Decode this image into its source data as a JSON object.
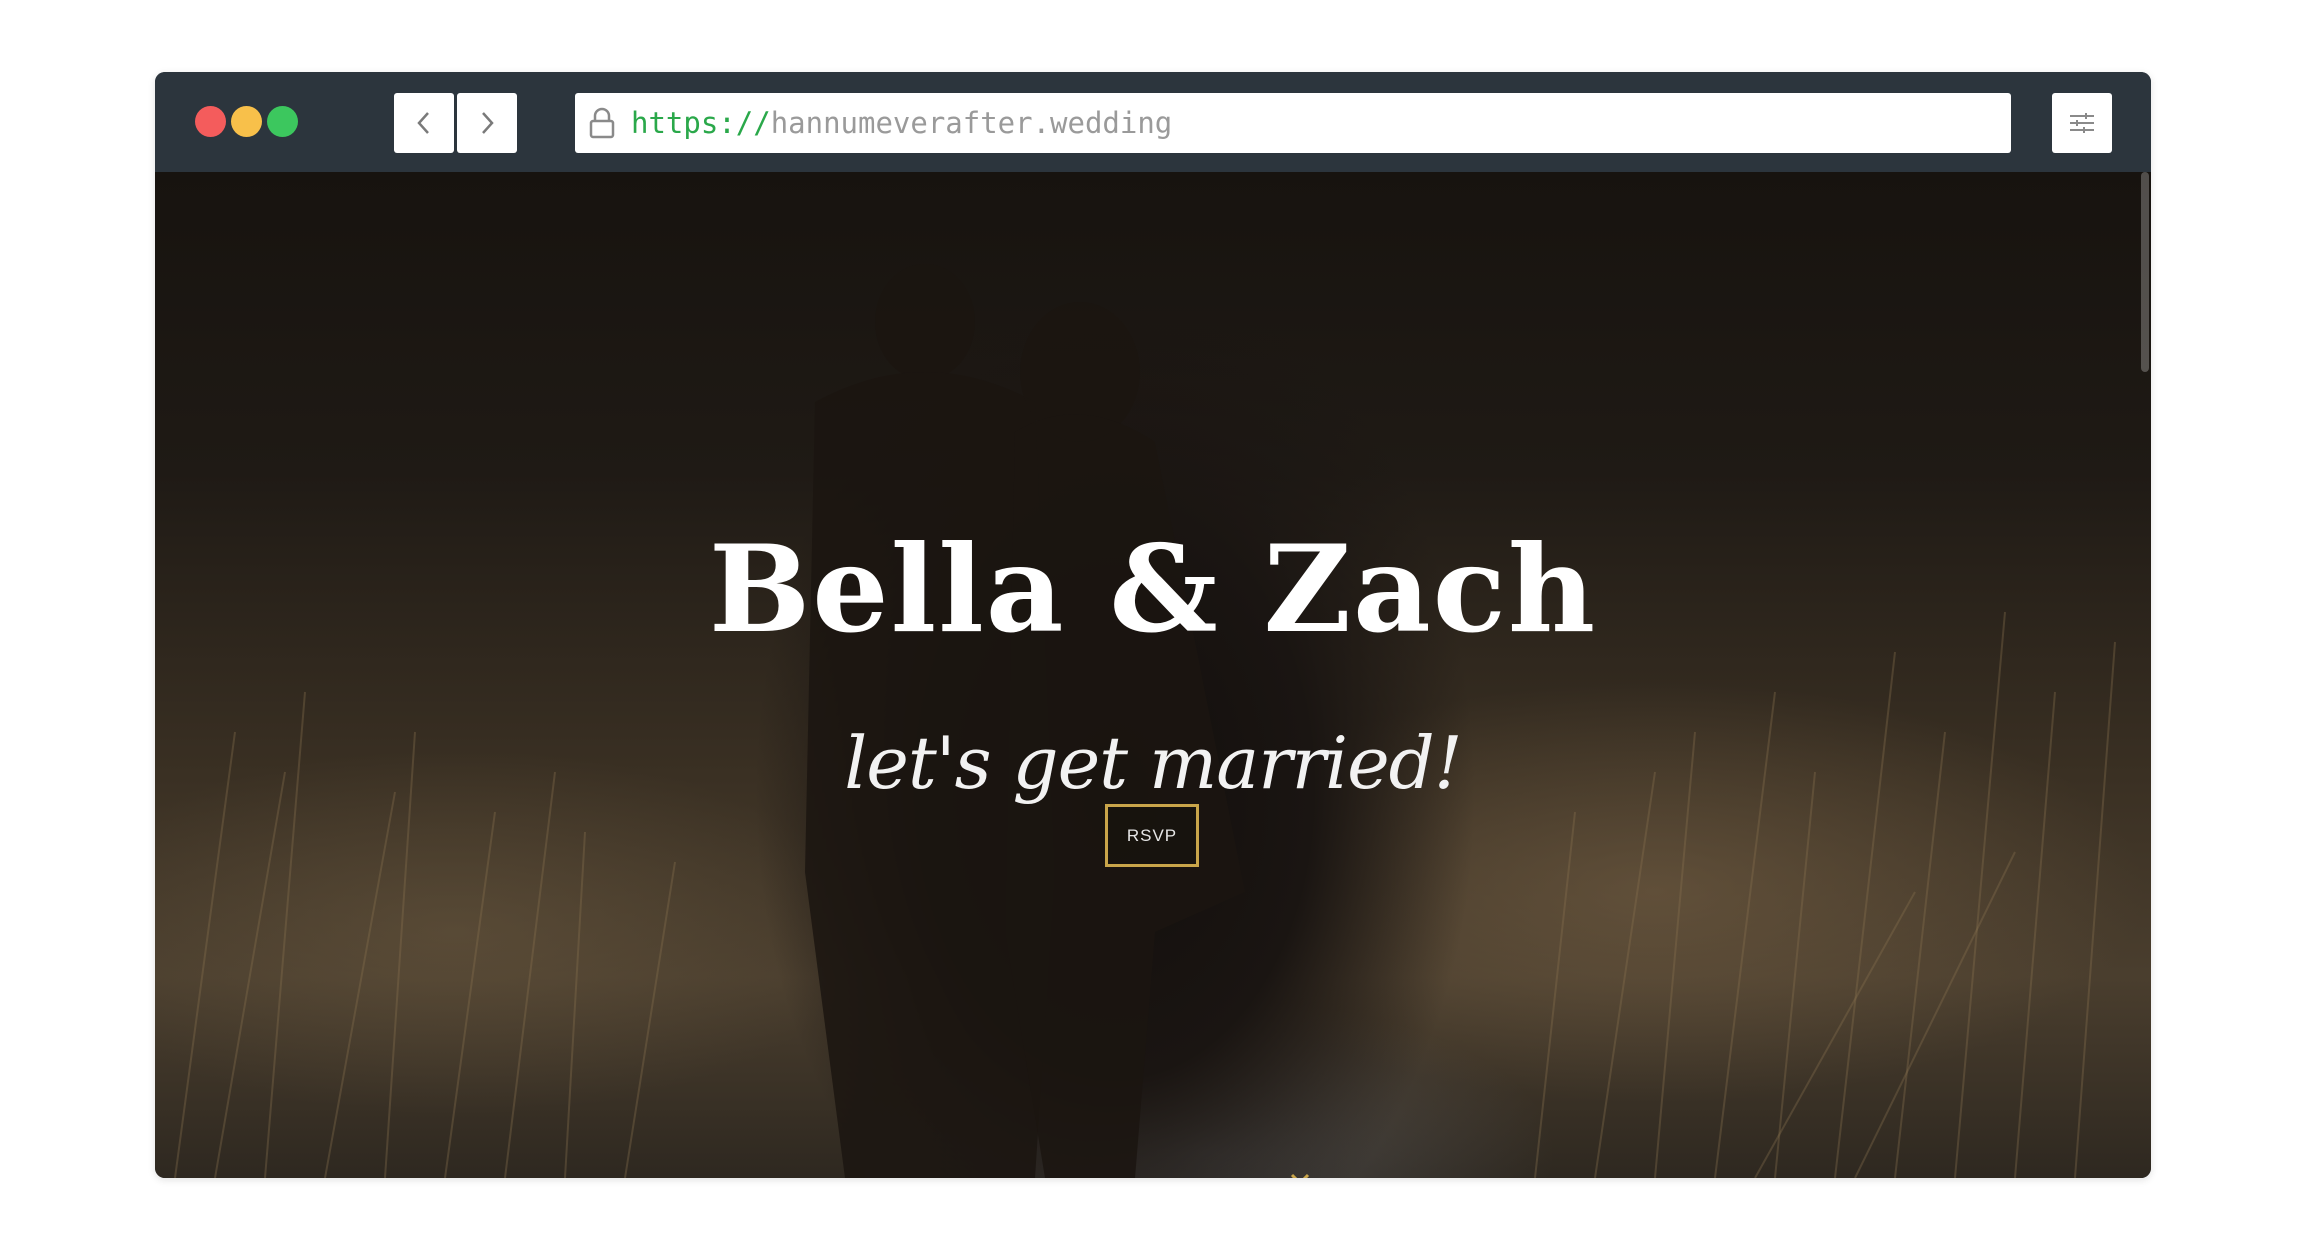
{
  "browser": {
    "url_scheme": "https://",
    "url_host": "hannumeverafter.wedding",
    "icons": {
      "back": "chevron-left-icon",
      "forward": "chevron-right-icon",
      "lock": "lock-icon",
      "menu": "sliders-icon"
    },
    "colors": {
      "chrome": "#2c353d",
      "close": "#f45c5c",
      "minimize": "#f8c04a",
      "maximize": "#3cc75e",
      "scheme": "#2aa84a"
    }
  },
  "hero": {
    "title": "Bella & Zach",
    "tagline": "let's get married!",
    "rsvp_label": "RSVP",
    "scroll_icon": "chevron-down-icon",
    "accent": "#c9a54a"
  }
}
